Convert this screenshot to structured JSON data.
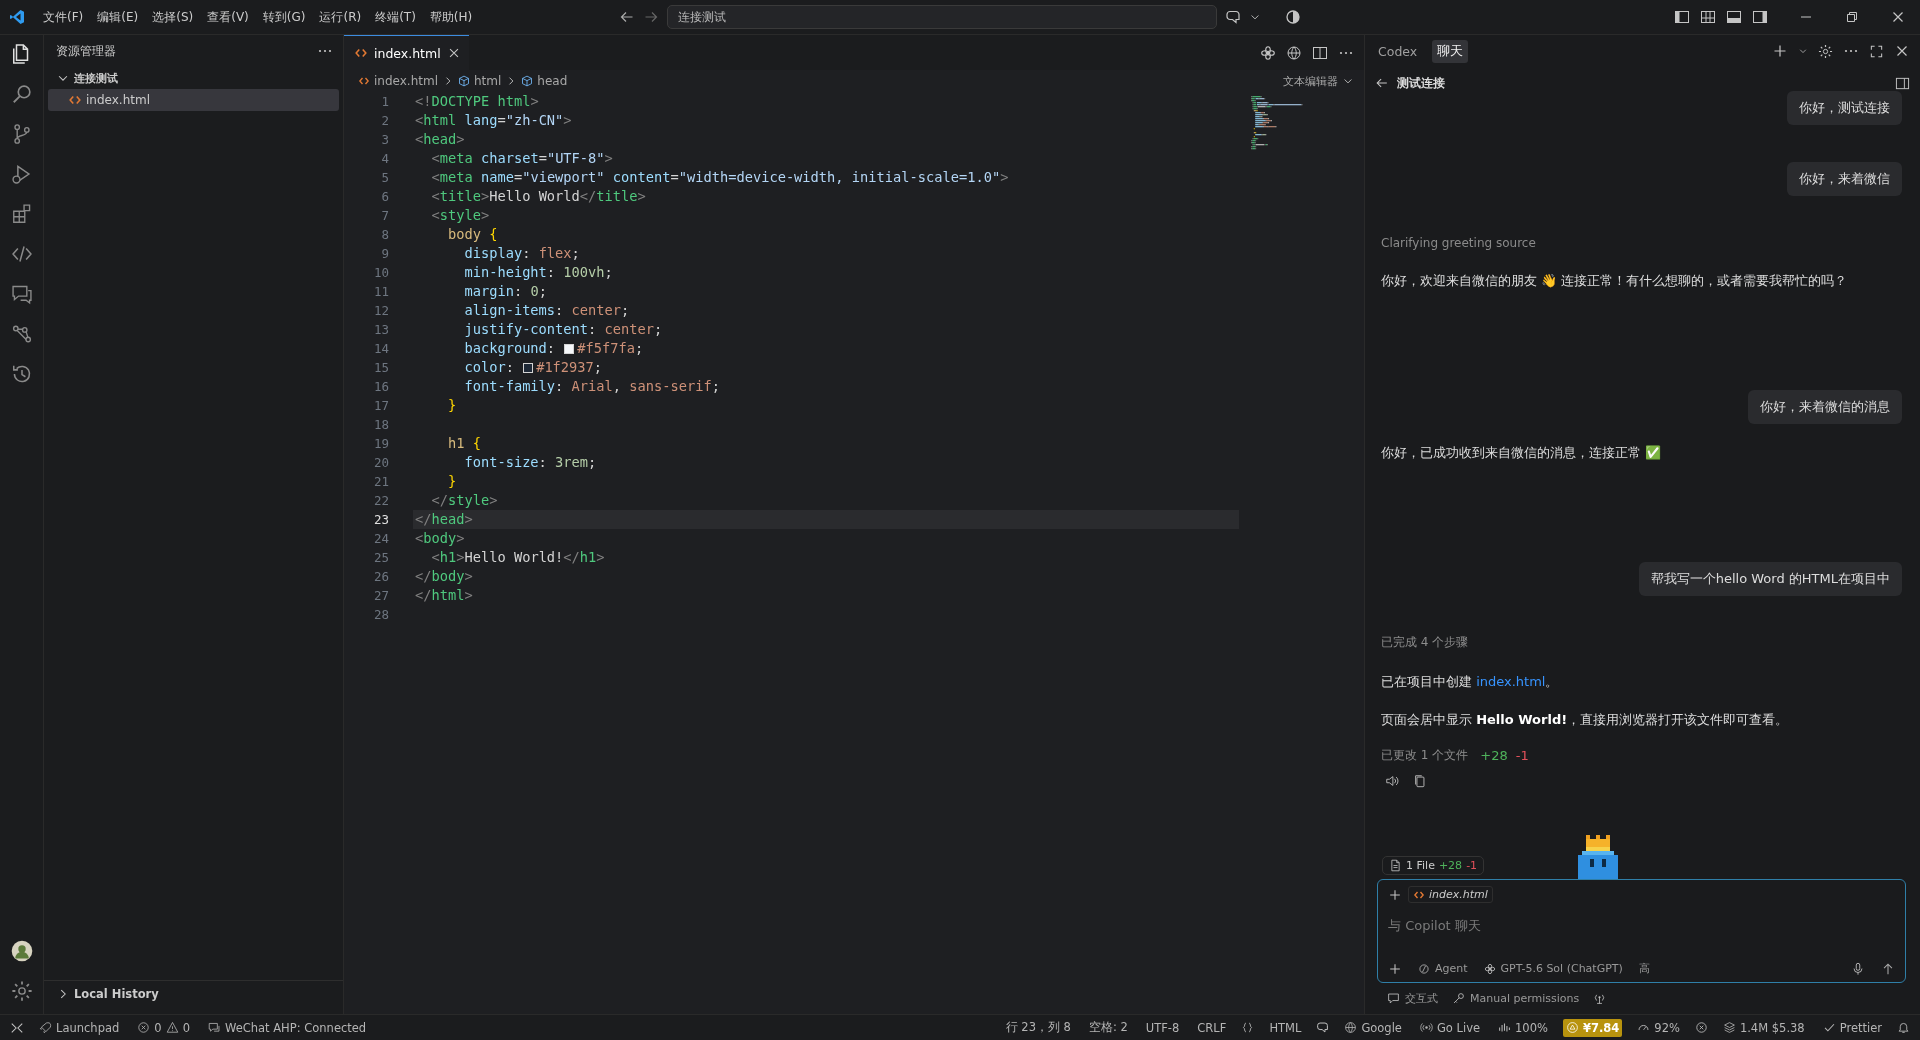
{
  "title_bar": {
    "menu": [
      "文件(F)",
      "编辑(E)",
      "选择(S)",
      "查看(V)",
      "转到(G)",
      "运行(R)",
      "终端(T)",
      "帮助(H)"
    ],
    "search": {
      "value": "连接测试"
    }
  },
  "sidebar": {
    "title": "资源管理器",
    "folders": [
      {
        "label": "连接测试",
        "expanded": true,
        "children": [
          {
            "label": "index.html",
            "selected": true
          }
        ]
      }
    ],
    "bottom_section": {
      "label": "Local History",
      "expanded": false
    }
  },
  "editor": {
    "tabs": [
      {
        "label": "index.html",
        "selected": true
      }
    ],
    "breadcrumbs": [
      "index.html",
      "html",
      "head"
    ],
    "view_mode": "文本编辑器",
    "lines": [
      {
        "number": "1",
        "current": false,
        "tokens": [
          {
            "kind": "punct",
            "text": "<!"
          },
          {
            "kind": "tag",
            "text": "DOCTYPE html"
          },
          {
            "kind": "punct",
            "text": ">"
          }
        ]
      },
      {
        "number": "2",
        "current": false,
        "tokens": [
          {
            "kind": "punct",
            "text": "<"
          },
          {
            "kind": "tag",
            "text": "html"
          },
          {
            "kind": "attr",
            "text": " lang"
          },
          {
            "kind": "text",
            "text": "="
          },
          {
            "kind": "string",
            "text": "\"zh-CN\""
          },
          {
            "kind": "punct",
            "text": ">"
          }
        ]
      },
      {
        "number": "3",
        "current": false,
        "tokens": [
          {
            "kind": "punct",
            "text": "<"
          },
          {
            "kind": "tag",
            "text": "head"
          },
          {
            "kind": "punct",
            "text": ">"
          }
        ]
      },
      {
        "number": "4",
        "current": false,
        "tokens": [
          {
            "kind": "punct",
            "text": "  <"
          },
          {
            "kind": "tag",
            "text": "meta"
          },
          {
            "kind": "attr",
            "text": " charset"
          },
          {
            "kind": "text",
            "text": "="
          },
          {
            "kind": "string",
            "text": "\"UTF-8\""
          },
          {
            "kind": "punct",
            "text": ">"
          }
        ]
      },
      {
        "number": "5",
        "current": false,
        "tokens": [
          {
            "kind": "punct",
            "text": "  <"
          },
          {
            "kind": "tag",
            "text": "meta"
          },
          {
            "kind": "attr",
            "text": " name"
          },
          {
            "kind": "text",
            "text": "="
          },
          {
            "kind": "string",
            "text": "\"viewport\""
          },
          {
            "kind": "attr",
            "text": " content"
          },
          {
            "kind": "text",
            "text": "="
          },
          {
            "kind": "string",
            "text": "\"width=device-width, initial-scale=1.0\""
          },
          {
            "kind": "punct",
            "text": ">"
          }
        ]
      },
      {
        "number": "6",
        "current": false,
        "tokens": [
          {
            "kind": "punct",
            "text": "  <"
          },
          {
            "kind": "tag",
            "text": "title"
          },
          {
            "kind": "punct",
            "text": ">"
          },
          {
            "kind": "text",
            "text": "Hello World"
          },
          {
            "kind": "punct",
            "text": "</"
          },
          {
            "kind": "tag",
            "text": "title"
          },
          {
            "kind": "punct",
            "text": ">"
          }
        ]
      },
      {
        "number": "7",
        "current": false,
        "tokens": [
          {
            "kind": "punct",
            "text": "  <"
          },
          {
            "kind": "tag",
            "text": "style"
          },
          {
            "kind": "punct",
            "text": ">"
          }
        ]
      },
      {
        "number": "8",
        "current": false,
        "tokens": [
          {
            "kind": "selector",
            "text": "    body "
          },
          {
            "kind": "brace",
            "text": "{"
          }
        ]
      },
      {
        "number": "9",
        "current": false,
        "tokens": [
          {
            "kind": "prop",
            "text": "      display"
          },
          {
            "kind": "text",
            "text": ": "
          },
          {
            "kind": "value",
            "text": "flex"
          },
          {
            "kind": "text",
            "text": ";"
          }
        ]
      },
      {
        "number": "10",
        "current": false,
        "tokens": [
          {
            "kind": "prop",
            "text": "      min-height"
          },
          {
            "kind": "text",
            "text": ": "
          },
          {
            "kind": "number",
            "text": "100vh"
          },
          {
            "kind": "text",
            "text": ";"
          }
        ]
      },
      {
        "number": "11",
        "current": false,
        "tokens": [
          {
            "kind": "prop",
            "text": "      margin"
          },
          {
            "kind": "text",
            "text": ": "
          },
          {
            "kind": "number",
            "text": "0"
          },
          {
            "kind": "text",
            "text": ";"
          }
        ]
      },
      {
        "number": "12",
        "current": false,
        "tokens": [
          {
            "kind": "prop",
            "text": "      align-items"
          },
          {
            "kind": "text",
            "text": ": "
          },
          {
            "kind": "value",
            "text": "center"
          },
          {
            "kind": "text",
            "text": ";"
          }
        ]
      },
      {
        "number": "13",
        "current": false,
        "tokens": [
          {
            "kind": "prop",
            "text": "      justify-content"
          },
          {
            "kind": "text",
            "text": ": "
          },
          {
            "kind": "value",
            "text": "center"
          },
          {
            "kind": "text",
            "text": ";"
          }
        ]
      },
      {
        "number": "14",
        "current": false,
        "tokens": [
          {
            "kind": "prop",
            "text": "      background"
          },
          {
            "kind": "text",
            "text": ": "
          },
          {
            "kind": "swatch",
            "color": "#f5f7fa"
          },
          {
            "kind": "value",
            "text": "#f5f7fa"
          },
          {
            "kind": "text",
            "text": ";"
          }
        ]
      },
      {
        "number": "15",
        "current": false,
        "tokens": [
          {
            "kind": "prop",
            "text": "      color"
          },
          {
            "kind": "text",
            "text": ": "
          },
          {
            "kind": "swatch",
            "color": "#1f2937"
          },
          {
            "kind": "value",
            "text": "#1f2937"
          },
          {
            "kind": "text",
            "text": ";"
          }
        ]
      },
      {
        "number": "16",
        "current": false,
        "tokens": [
          {
            "kind": "prop",
            "text": "      font-family"
          },
          {
            "kind": "text",
            "text": ": "
          },
          {
            "kind": "value",
            "text": "Arial"
          },
          {
            "kind": "text",
            "text": ", "
          },
          {
            "kind": "value",
            "text": "sans-serif"
          },
          {
            "kind": "text",
            "text": ";"
          }
        ]
      },
      {
        "number": "17",
        "current": false,
        "tokens": [
          {
            "kind": "brace",
            "text": "    }"
          }
        ]
      },
      {
        "number": "18",
        "current": false
      },
      {
        "number": "19",
        "current": false,
        "tokens": [
          {
            "kind": "selector",
            "text": "    h1 "
          },
          {
            "kind": "brace",
            "text": "{"
          }
        ]
      },
      {
        "number": "20",
        "current": false,
        "tokens": [
          {
            "kind": "prop",
            "text": "      font-size"
          },
          {
            "kind": "text",
            "text": ": "
          },
          {
            "kind": "number",
            "text": "3rem"
          },
          {
            "kind": "text",
            "text": ";"
          }
        ]
      },
      {
        "number": "21",
        "current": false,
        "tokens": [
          {
            "kind": "brace",
            "text": "    }"
          }
        ]
      },
      {
        "number": "22",
        "current": false,
        "tokens": [
          {
            "kind": "punct",
            "text": "  </"
          },
          {
            "kind": "tag",
            "text": "style"
          },
          {
            "kind": "punct",
            "text": ">"
          }
        ]
      },
      {
        "number": "23",
        "current": true,
        "tokens": [
          {
            "kind": "punct",
            "text": "</"
          },
          {
            "kind": "tag",
            "text": "head"
          },
          {
            "kind": "punct",
            "text": ">"
          }
        ]
      },
      {
        "number": "24",
        "current": false,
        "tokens": [
          {
            "kind": "punct",
            "text": "<"
          },
          {
            "kind": "tag",
            "text": "body"
          },
          {
            "kind": "punct",
            "text": ">"
          }
        ]
      },
      {
        "number": "25",
        "current": false,
        "tokens": [
          {
            "kind": "punct",
            "text": "  <"
          },
          {
            "kind": "tag",
            "text": "h1"
          },
          {
            "kind": "punct",
            "text": ">"
          },
          {
            "kind": "text",
            "text": "Hello World!"
          },
          {
            "kind": "punct",
            "text": "</"
          },
          {
            "kind": "tag",
            "text": "h1"
          },
          {
            "kind": "punct",
            "text": ">"
          }
        ]
      },
      {
        "number": "26",
        "current": false,
        "tokens": [
          {
            "kind": "punct",
            "text": "</"
          },
          {
            "kind": "tag",
            "text": "body"
          },
          {
            "kind": "punct",
            "text": ">"
          }
        ]
      },
      {
        "number": "27",
        "current": false,
        "tokens": [
          {
            "kind": "punct",
            "text": "</"
          },
          {
            "kind": "tag",
            "text": "html"
          },
          {
            "kind": "punct",
            "text": ">"
          }
        ]
      },
      {
        "number": "28",
        "current": false
      }
    ]
  },
  "chat": {
    "tabs": [
      {
        "label": "Codex",
        "selected": false
      },
      {
        "label": "聊天",
        "selected": true
      }
    ],
    "title": "测试连接",
    "messages": [
      {
        "kind": "user",
        "text": "你好，测试连接"
      },
      {
        "kind": "user",
        "text": "你好，来着微信"
      },
      {
        "kind": "status",
        "text": "Clarifying greeting source"
      },
      {
        "kind": "assistant",
        "text": "你好，欢迎来自微信的朋友 👋 连接正常！有什么想聊的，或者需要我帮忙的吗？"
      },
      {
        "kind": "user",
        "text": "你好，来着微信的消息"
      },
      {
        "kind": "assistant",
        "text": "你好，已成功收到来自微信的消息，连接正常 ✅"
      },
      {
        "kind": "user",
        "text": "帮我写一个hello Word 的HTML在项目中"
      },
      {
        "kind": "steps",
        "text": "已完成 4 个步骤"
      },
      {
        "kind": "assistant",
        "text": "已在项目中创建 ",
        "link": "index.html",
        "after": "。"
      },
      {
        "kind": "assistant",
        "text": "页面会居中显示 **Hello World!**，直接用浏览器打开该文件即可查看。"
      },
      {
        "kind": "changes",
        "text": "已更改 1 个文件",
        "added": "+28",
        "removed": "-1"
      }
    ],
    "file_chip": {
      "label": "1 File",
      "added": "+28",
      "removed": "-1"
    },
    "input": {
      "attachment": "index.html",
      "placeholder": "与 Copilot 聊天",
      "mode": "Agent",
      "model": "GPT-5.6 Sol (ChatGPT)",
      "effort": "高"
    },
    "footer": [
      "交互式",
      "Manual permissions"
    ]
  },
  "status_bar": {
    "left": [
      {
        "kind": "launchpad",
        "text": "Launchpad"
      },
      {
        "kind": "problems",
        "errors": "0",
        "warnings": "0"
      },
      {
        "kind": "wechat",
        "text": "WeChat AHP: Connected"
      }
    ],
    "right": [
      {
        "kind": "plain",
        "text": "行 23，列 8",
        "highlighted": false
      },
      {
        "kind": "plain",
        "text": "空格: 2",
        "highlighted": false
      },
      {
        "kind": "plain",
        "text": "UTF-8",
        "highlighted": false
      },
      {
        "kind": "plain",
        "text": "CRLF",
        "highlighted": false
      },
      {
        "kind": "language",
        "text": "HTML",
        "highlighted": false
      },
      {
        "kind": "globe",
        "text": "Google",
        "highlighted": false
      },
      {
        "kind": "golive",
        "text": "Go Live",
        "highlighted": false
      },
      {
        "kind": "zoom",
        "text": "100%",
        "highlighted": false
      },
      {
        "kind": "cost",
        "text": "¥7.84",
        "highlighted": true
      },
      {
        "kind": "gauge",
        "text": "92%",
        "highlighted": false
      },
      {
        "kind": "usage",
        "text": "1.4M $5.38",
        "highlighted": false
      },
      {
        "kind": "check",
        "text": "Prettier",
        "highlighted": false
      }
    ]
  }
}
